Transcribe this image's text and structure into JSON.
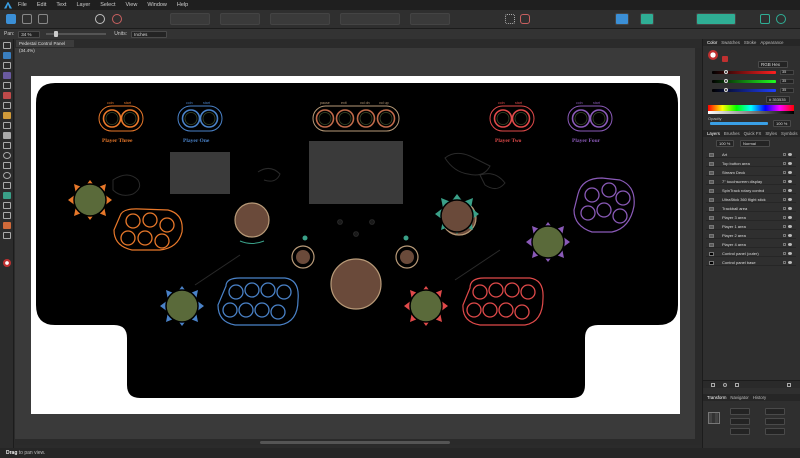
{
  "menu": [
    "File",
    "Edit",
    "Text",
    "Layer",
    "Select",
    "View",
    "Window",
    "Help"
  ],
  "context": {
    "pan_label": "Pan:",
    "zoom_value": "34 %",
    "units_label": "Units:",
    "units_value": "Inches"
  },
  "document": {
    "tab_title": "Pedestal Control Panel (34.4%)"
  },
  "panel": {
    "labels": {
      "player_three": "Player Three",
      "player_one": "Player One",
      "player_two": "Player Two",
      "player_four": "Player Four",
      "coin": "coin",
      "start": "start",
      "pause": "pause",
      "exit": "exit",
      "vol_up": "vol up",
      "vol_dn": "vol dn",
      "select": "select"
    },
    "colors": {
      "player_three": "#e8782a",
      "player_one": "#4a82c8",
      "player_two": "#e04a4a",
      "player_four": "#8a5ab8",
      "neutral": "#b89a78",
      "panel": "#000000",
      "button_fill": "#5a6a3a",
      "trackball_fill": "#6a4a3a",
      "display_fill": "#3a3a3a"
    }
  },
  "right_panel": {
    "color_tabs": [
      "Color",
      "Swatches",
      "Stroke",
      "Appearance"
    ],
    "color_model": "RGB Hex",
    "rgb": {
      "r": "35",
      "g": "35",
      "b": "35"
    },
    "hex": "# 353535",
    "opacity_label": "Opacity",
    "opacity_value": "100 %",
    "layer_tabs": [
      "Layers",
      "Brushes",
      "Quick FX",
      "Styles",
      "Symbols"
    ],
    "layer_opacity": "100 %",
    "blend_mode": "Normal",
    "layers": [
      "Art",
      "Top button area",
      "Stream Deck",
      "7\" touchscreen display",
      "SpinTrack rotary control",
      "UltraStick 360 flight stick",
      "Trackball area",
      "Player 3 area",
      "Player 1 area",
      "Player 2 area",
      "Player 4 area",
      "Control panel (outer)",
      "Control panel base"
    ],
    "bottom_tabs": [
      "Transform",
      "Navigator",
      "History"
    ]
  },
  "status": {
    "bold": "Drag",
    "rest": "to pan view."
  }
}
